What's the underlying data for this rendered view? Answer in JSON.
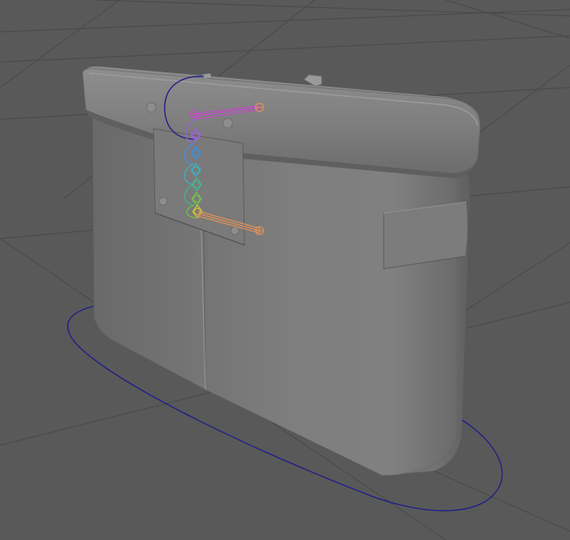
{
  "viewport": {
    "background": "#595959",
    "grid_color": "#4a4a4a",
    "mesh_color": "#7d7d7d",
    "curve_color": "#1d1a8c"
  },
  "scene": {
    "object": "mesh",
    "icons": [
      "grid-floor",
      "box-mesh",
      "ring-control",
      "joint-chain",
      "ground-control-curve"
    ]
  },
  "joint_chain": {
    "colors": [
      "#c24ac7",
      "#9e62e3",
      "#3d8fe0",
      "#3fb0c0",
      "#45b58a",
      "#6fc24a",
      "#c7c23a",
      "#e0905a"
    ]
  }
}
